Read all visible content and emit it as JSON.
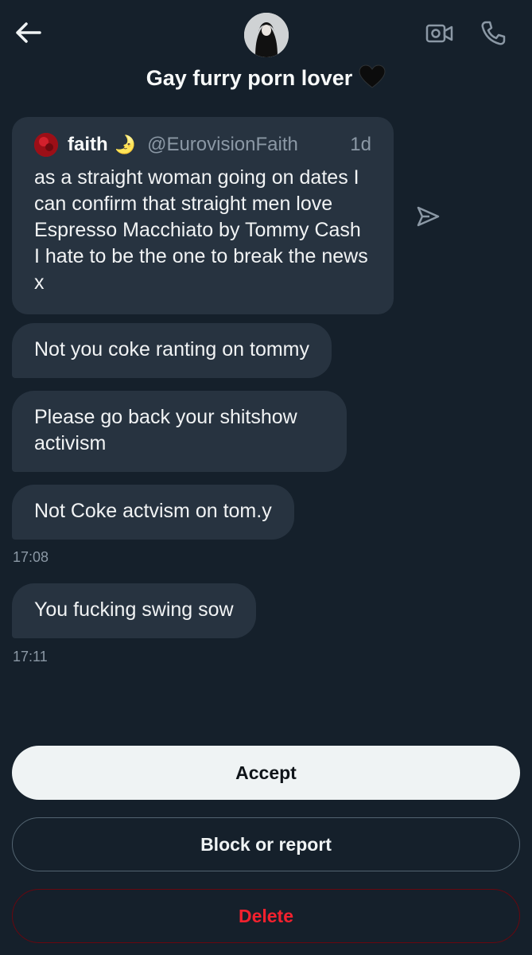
{
  "header": {
    "title": "Gay furry porn lover",
    "title_emoji": "🖤"
  },
  "quoted_post": {
    "name": "faith",
    "name_emoji": "🌛",
    "handle": "@EurovisionFaith",
    "time": "1d",
    "text": "as a straight woman going on dates I can confirm that straight men love Espresso Macchiato by Tommy Cash I hate to be the one to break the news x"
  },
  "messages": [
    {
      "text": "Not you coke ranting on tommy"
    },
    {
      "text": "Please go back your shitshow activism"
    },
    {
      "text": "Not Coke actvism on tom.y",
      "timestamp": "17:08"
    },
    {
      "text": "You fucking swing sow",
      "timestamp": "17:11"
    }
  ],
  "actions": {
    "accept": "Accept",
    "block_or_report": "Block or report",
    "delete": "Delete"
  },
  "colors": {
    "background": "#15202b",
    "bubble": "#273340",
    "muted_text": "#8b98a5",
    "delete_red": "#f4212e"
  }
}
